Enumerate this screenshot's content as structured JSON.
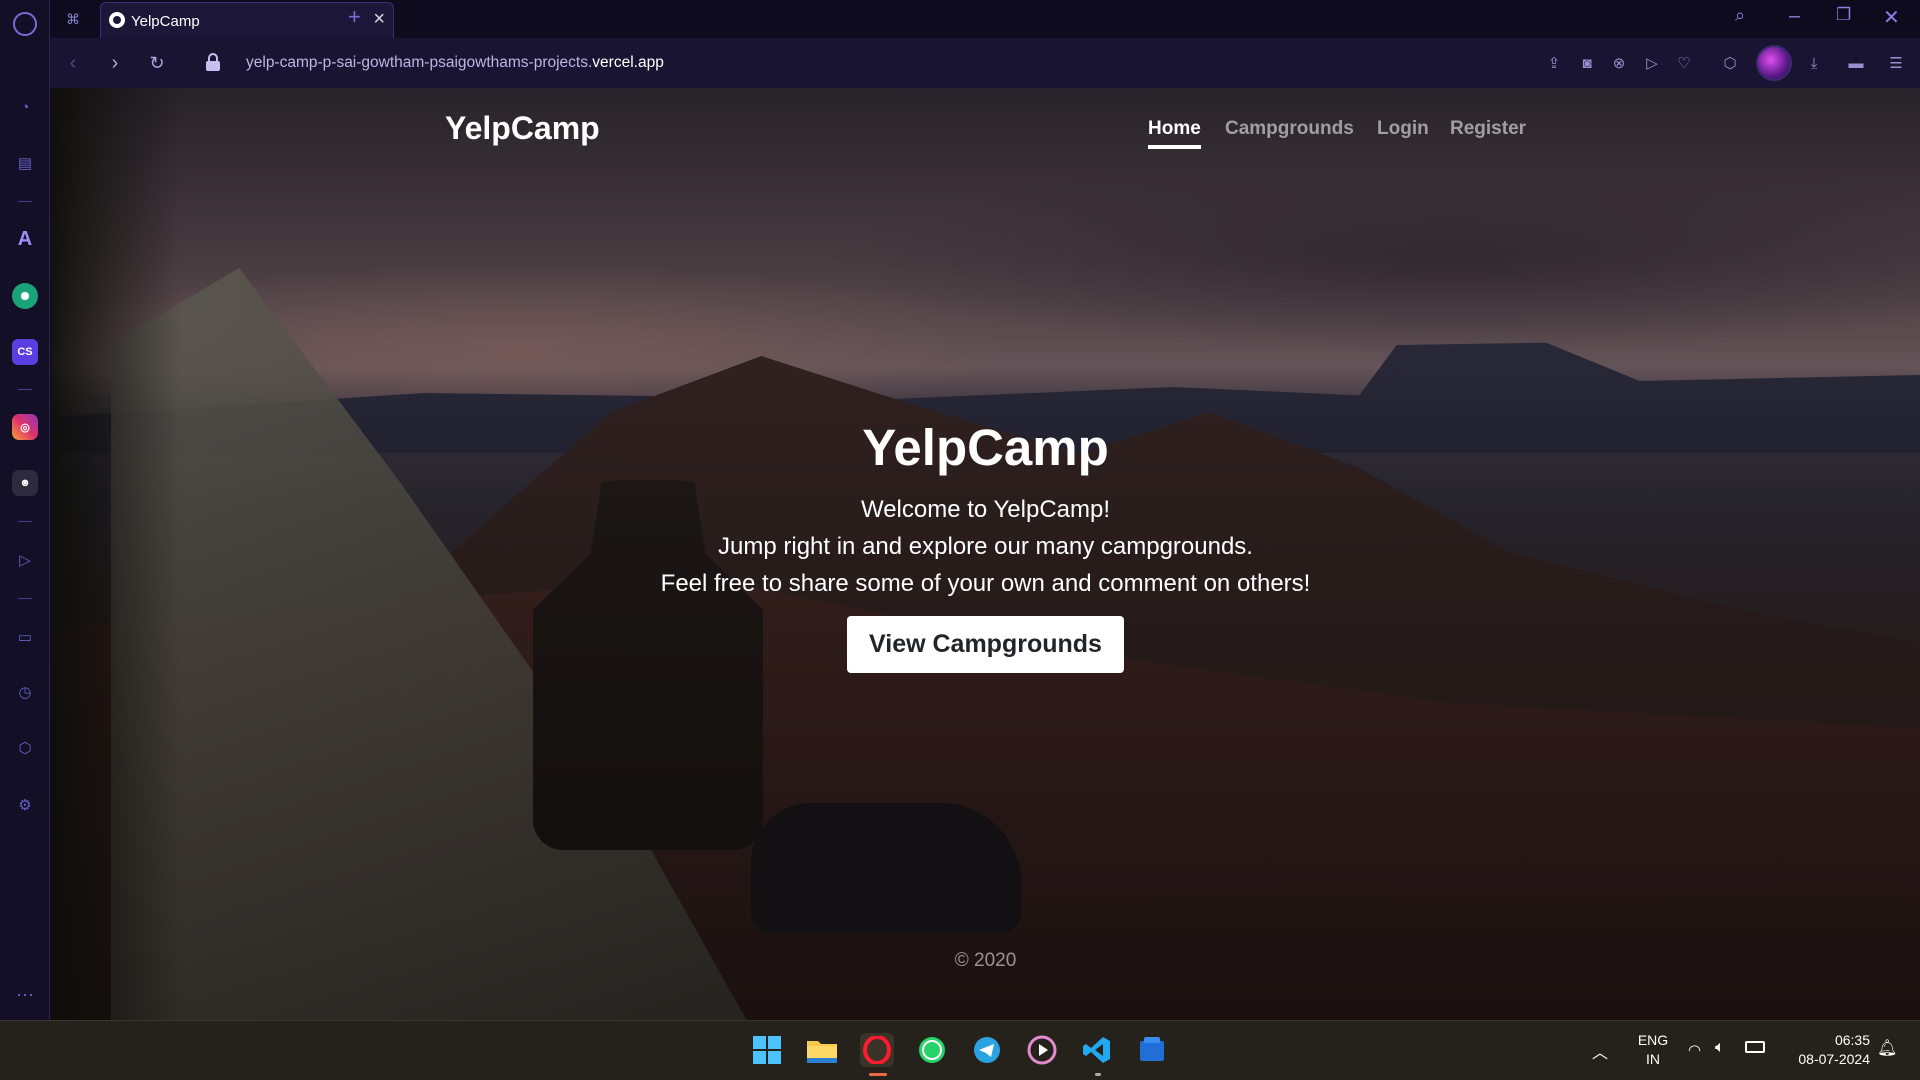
{
  "browser": {
    "tab_title": "YelpCamp",
    "url_prefix": "yelp-camp-p-sai-gowtham-psaigowthams-projects.",
    "url_domain": "vercel.app",
    "accent_color": "#7a6cd6"
  },
  "site": {
    "brand": "YelpCamp",
    "nav": {
      "home": "Home",
      "campgrounds": "Campgrounds",
      "login": "Login",
      "register": "Register"
    },
    "hero": {
      "title": "YelpCamp",
      "line1": "Welcome to YelpCamp!",
      "line2": "Jump right in and explore our many campgrounds.",
      "line3": "Feel free to share some of your own and comment on others!",
      "cta": "View Campgrounds"
    },
    "footer": "© 2020"
  },
  "taskbar": {
    "language": "ENG",
    "region": "IN",
    "time": "06:35",
    "date": "08-07-2024"
  }
}
